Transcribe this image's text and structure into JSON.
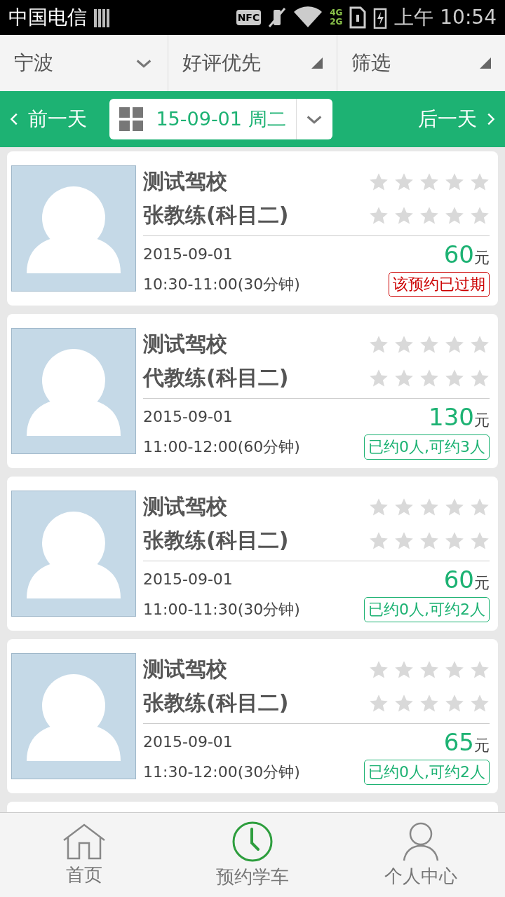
{
  "status_bar": {
    "carrier": "中国电信",
    "nfc": "NFC",
    "network_types": [
      "4G",
      "2G"
    ],
    "time": "上午 10:54"
  },
  "filters": [
    {
      "label": "宁波",
      "kind": "chevron"
    },
    {
      "label": "好评优先",
      "kind": "corner"
    },
    {
      "label": "筛选",
      "kind": "corner"
    }
  ],
  "date_bar": {
    "prev": "前一天",
    "date": "15-09-01 周二",
    "next": "后一天"
  },
  "lessons": [
    {
      "school": "测试驾校",
      "coach": "张教练(科目二)",
      "ratings": [
        {
          "stars": 0
        },
        {
          "stars": 0
        }
      ],
      "date": "2015-09-01",
      "price": "60",
      "unit": "元",
      "time": "10:30-11:00(30分钟)",
      "status": {
        "text": "该预约已过期",
        "kind": "expired"
      }
    },
    {
      "school": "测试驾校",
      "coach": "代教练(科目二)",
      "ratings": [
        {
          "stars": 0
        },
        {
          "stars": 0
        }
      ],
      "date": "2015-09-01",
      "price": "130",
      "unit": "元",
      "time": "11:00-12:00(60分钟)",
      "status": {
        "text": "已约0人,可约3人",
        "kind": "available"
      }
    },
    {
      "school": "测试驾校",
      "coach": "张教练(科目二)",
      "ratings": [
        {
          "stars": 0
        },
        {
          "stars": 0
        }
      ],
      "date": "2015-09-01",
      "price": "60",
      "unit": "元",
      "time": "11:00-11:30(30分钟)",
      "status": {
        "text": "已约0人,可约2人",
        "kind": "available"
      }
    },
    {
      "school": "测试驾校",
      "coach": "张教练(科目二)",
      "ratings": [
        {
          "stars": 0
        },
        {
          "stars": 0
        }
      ],
      "date": "2015-09-01",
      "price": "65",
      "unit": "元",
      "time": "11:30-12:00(30分钟)",
      "status": {
        "text": "已约0人,可约2人",
        "kind": "available"
      }
    }
  ],
  "bottom_nav": [
    {
      "label": "首页",
      "selected": false
    },
    {
      "label": "预约学车",
      "selected": true
    },
    {
      "label": "个人中心",
      "selected": false
    }
  ]
}
